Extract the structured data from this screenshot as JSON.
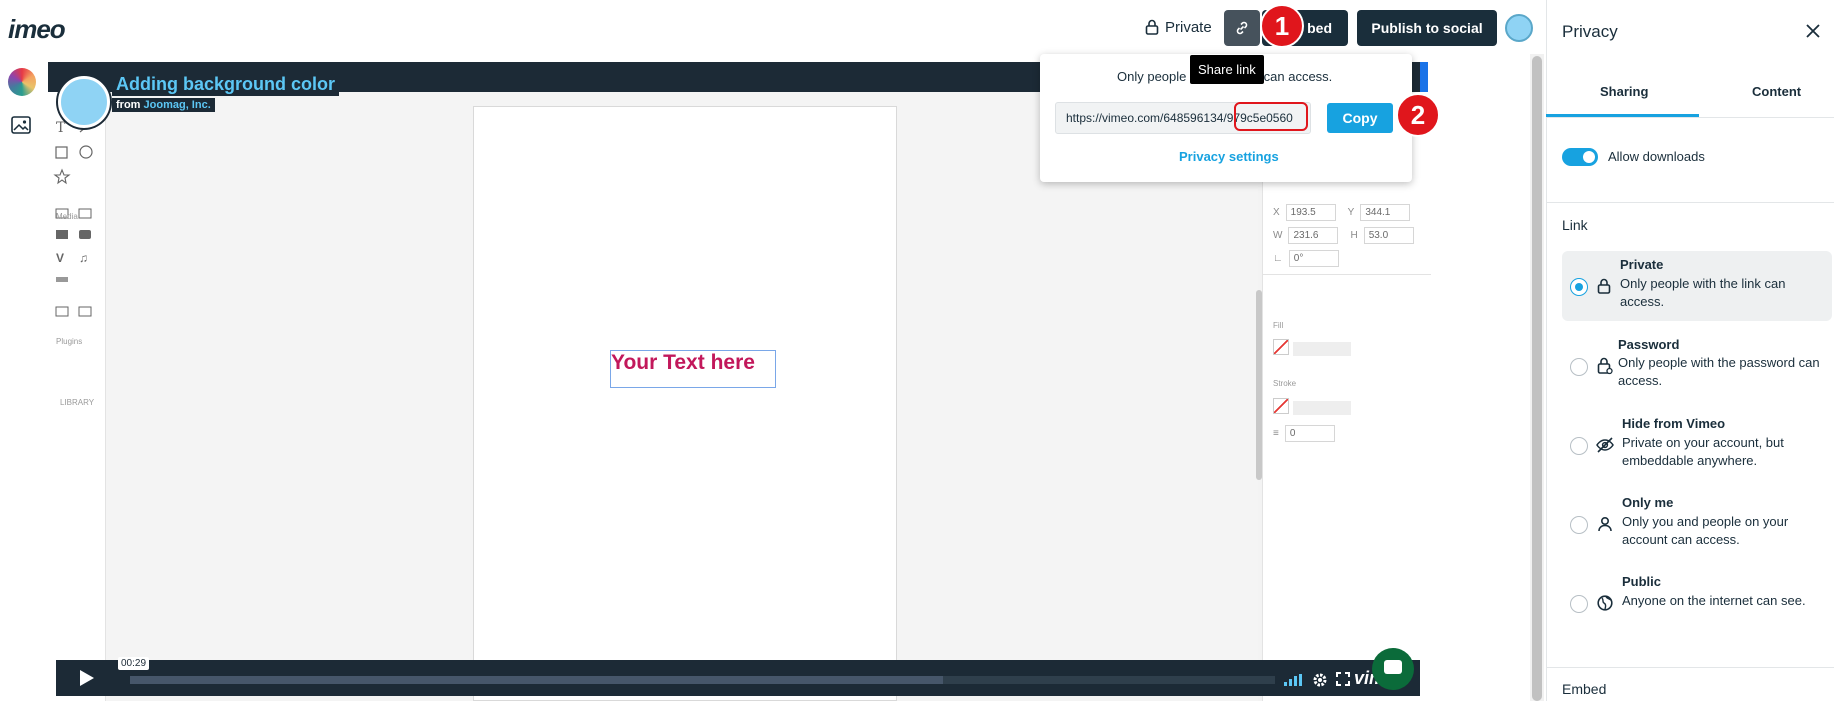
{
  "app": {
    "logo": "imeo"
  },
  "topbar": {
    "privacy_label": "Private",
    "embed_label": "bed",
    "publish_label": "Publish to social"
  },
  "annotations": {
    "step1": "1",
    "step2": "2"
  },
  "video": {
    "title": "Adding background color",
    "from_prefix": "from",
    "from_org": "Joomag, Inc.",
    "canvas_text": "Your Text here",
    "timestamp": "00:29",
    "brand": "vimeo",
    "progress_fraction": 0.71
  },
  "editor": {
    "section_media": "Media",
    "section_plugins": "Plugins",
    "library_label": "LIBRARY",
    "fill_label": "Fill",
    "stroke_label": "Stroke",
    "props": {
      "x": "193.5",
      "y": "344.1",
      "w": "231.6",
      "h": "53.0",
      "angle": "0°",
      "stroke_width": "0"
    },
    "prop_labels": {
      "x": "X",
      "y": "Y",
      "w": "W",
      "h": "H"
    }
  },
  "share_popover": {
    "message_start": "Only people",
    "message_end": "can access.",
    "tooltip": "Share link",
    "url": "https://vimeo.com/648596134/979c5e0560",
    "copy_label": "Copy",
    "privacy_settings_label": "Privacy settings"
  },
  "panel": {
    "title": "Privacy",
    "tabs": [
      {
        "label": "Sharing",
        "active": true
      },
      {
        "label": "Content",
        "active": false
      }
    ],
    "allow_downloads_label": "Allow downloads",
    "allow_downloads_on": true,
    "link_heading": "Link",
    "options": [
      {
        "title": "Private",
        "desc": "Only people with the link can access.",
        "selected": true,
        "icon": "lock-icon"
      },
      {
        "title": "Password",
        "desc": "Only people with the password can access.",
        "selected": false,
        "icon": "password-lock-icon"
      },
      {
        "title": "Hide from Vimeo",
        "desc": "Private on your account, but embeddable anywhere.",
        "selected": false,
        "icon": "eye-off-icon"
      },
      {
        "title": "Only me",
        "desc": "Only you and people on your account can access.",
        "selected": false,
        "icon": "person-icon"
      },
      {
        "title": "Public",
        "desc": "Anyone on the internet can see.",
        "selected": false,
        "icon": "globe-icon"
      }
    ],
    "embed_heading": "Embed"
  },
  "colors": {
    "accent": "#17a2e0",
    "annotation_red": "#e0161c",
    "dark": "#1a2e3b"
  }
}
